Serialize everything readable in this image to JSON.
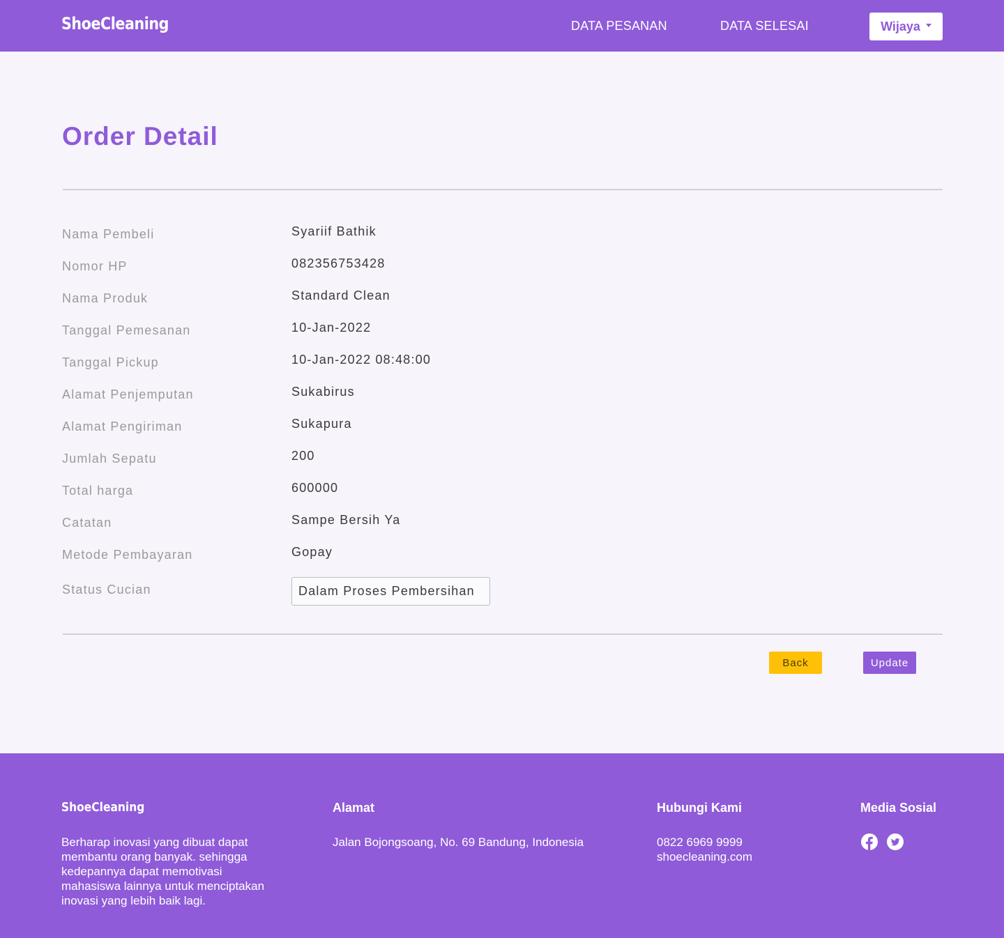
{
  "header": {
    "brand": "ShoeCleaning",
    "nav": [
      "DATA PESANAN",
      "DATA SELESAI"
    ],
    "user": "Wijaya"
  },
  "main": {
    "title": "Order Detail",
    "fields": [
      {
        "label": "Nama Pembeli",
        "value": "Syariif Bathik"
      },
      {
        "label": "Nomor HP",
        "value": "082356753428"
      },
      {
        "label": "Nama Produk",
        "value": "Standard Clean"
      },
      {
        "label": "Tanggal Pemesanan",
        "value": "10-Jan-2022"
      },
      {
        "label": "Tanggal Pickup",
        "value": "10-Jan-2022 08:48:00"
      },
      {
        "label": "Alamat Penjemputan",
        "value": "Sukabirus"
      },
      {
        "label": "Alamat Pengiriman",
        "value": "Sukapura"
      },
      {
        "label": "Jumlah Sepatu",
        "value": "200"
      },
      {
        "label": "Total harga",
        "value": "600000"
      },
      {
        "label": "Catatan",
        "value": "Sampe Bersih Ya"
      },
      {
        "label": "Metode Pembayaran",
        "value": "Gopay"
      }
    ],
    "status": {
      "label": "Status Cucian",
      "value": "Dalam Proses Pembersihan"
    },
    "buttons": {
      "back": "Back",
      "update": "Update"
    }
  },
  "footer": {
    "brand": "ShoeCleaning",
    "description": "Berharap inovasi yang dibuat dapat membantu orang banyak. sehingga kedepannya dapat memotivasi mahasiswa lainnya untuk menciptakan inovasi yang lebih baik lagi.",
    "address_heading": "Alamat",
    "address": "Jalan Bojongsoang, No. 69 Bandung, Indonesia",
    "contact_heading": "Hubungi Kami",
    "phone": "0822 6969 9999",
    "website": "shoecleaning.com",
    "social_heading": "Media Sosial",
    "social_icons": [
      "facebook-icon",
      "twitter-icon"
    ]
  },
  "colors": {
    "primary": "#8f5bd9",
    "back_button": "#ffc107",
    "background": "#f7f4fb"
  }
}
